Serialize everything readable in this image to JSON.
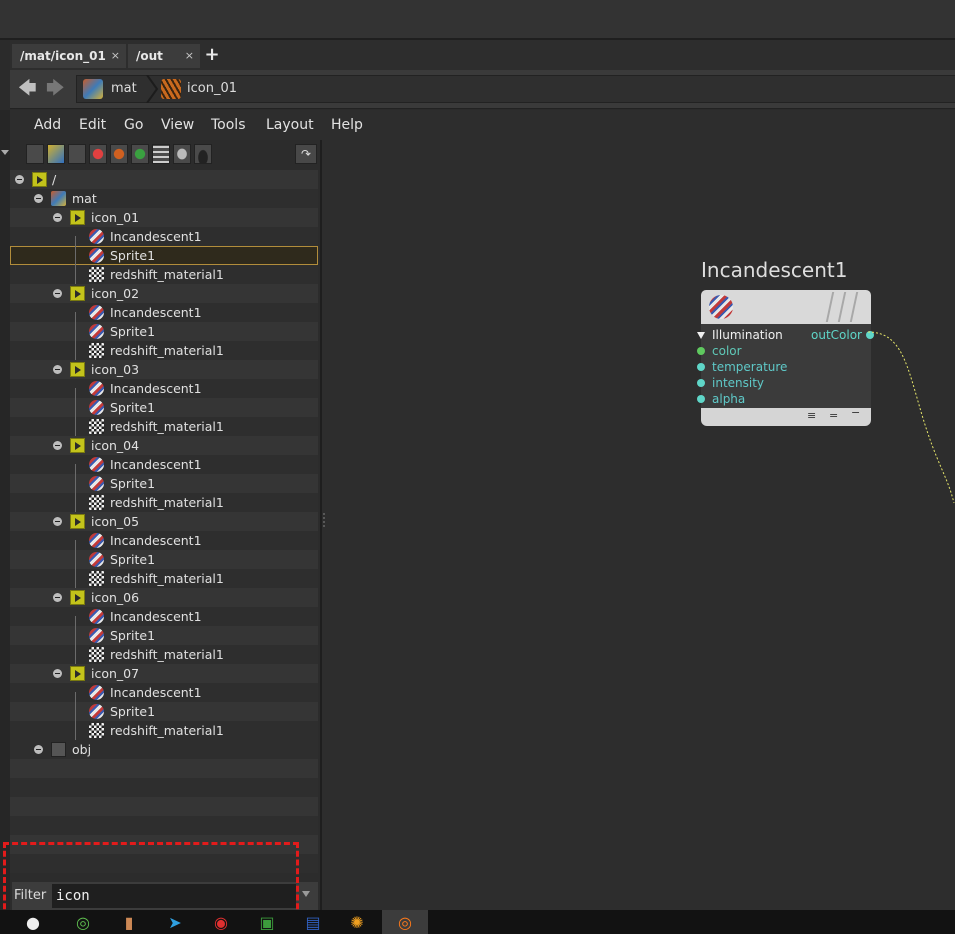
{
  "tabs": [
    {
      "label": "/mat/icon_01",
      "close": "×"
    },
    {
      "label": "/out",
      "close": "×"
    }
  ],
  "tab_add": "+",
  "breadcrumb": [
    "mat",
    "icon_01"
  ],
  "menu": [
    "Add",
    "Edit",
    "Go",
    "View",
    "Tools",
    "Layout",
    "Help"
  ],
  "tree": {
    "root": "/",
    "mat": "mat",
    "obj": "obj",
    "groups": [
      {
        "name": "icon_01",
        "children": [
          "Incandescent1",
          "Sprite1",
          "redshift_material1"
        ]
      },
      {
        "name": "icon_02",
        "children": [
          "Incandescent1",
          "Sprite1",
          "redshift_material1"
        ]
      },
      {
        "name": "icon_03",
        "children": [
          "Incandescent1",
          "Sprite1",
          "redshift_material1"
        ]
      },
      {
        "name": "icon_04",
        "children": [
          "Incandescent1",
          "Sprite1",
          "redshift_material1"
        ]
      },
      {
        "name": "icon_05",
        "children": [
          "Incandescent1",
          "Sprite1",
          "redshift_material1"
        ]
      },
      {
        "name": "icon_06",
        "children": [
          "Incandescent1",
          "Sprite1",
          "redshift_material1"
        ]
      },
      {
        "name": "icon_07",
        "children": [
          "Incandescent1",
          "Sprite1",
          "redshift_material1"
        ]
      }
    ],
    "selected": "icon_01/Sprite1"
  },
  "filter": {
    "label": "Filter",
    "value": "icon"
  },
  "node": {
    "title": "Incandescent1",
    "group": "Illumination",
    "output": "outColor",
    "inputs": [
      "color",
      "temperature",
      "intensity",
      "alpha"
    ],
    "footer_icons": [
      "≡",
      "=",
      "−"
    ]
  },
  "colors": {
    "highlight": "#e21b1b",
    "selection": "#b28d3b",
    "port_green": "#5fc95f",
    "port_cyan": "#5fd6c8",
    "wire": "#e6e66a"
  }
}
